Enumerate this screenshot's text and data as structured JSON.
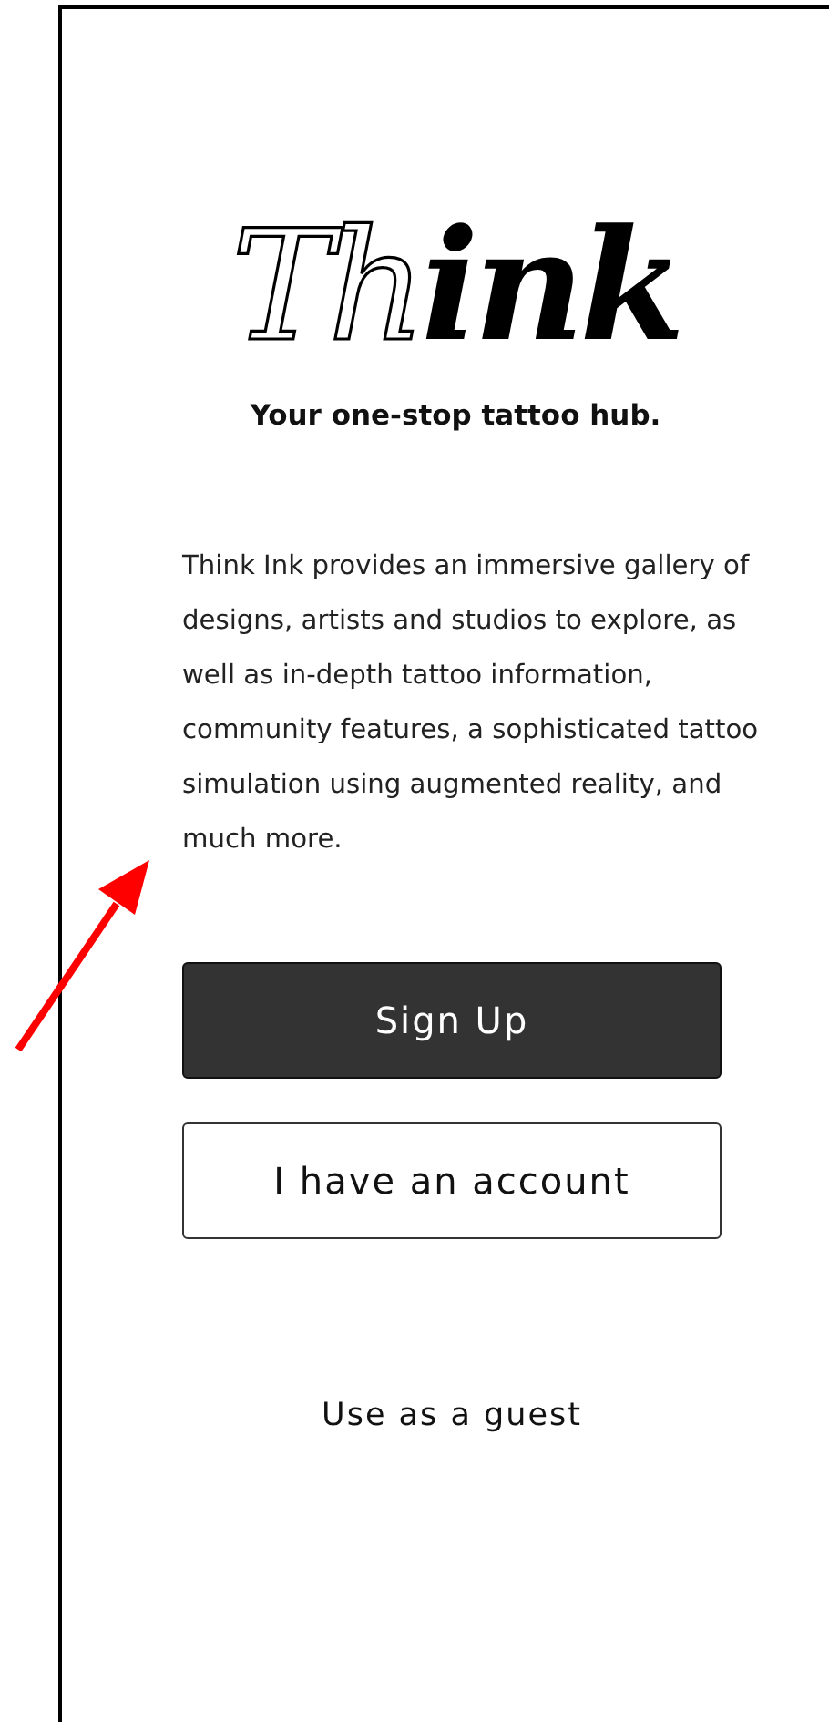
{
  "logo": {
    "outlined_part": "Th",
    "filled_part": "ink"
  },
  "tagline": "Your one-stop tattoo hub.",
  "description": "Think Ink provides an immersive gallery of designs, artists and studios to explore, as well as in-depth tattoo information, community features, a sophisticated tattoo simulation using augmented reality, and much more.",
  "actions": [
    {
      "label": "Sign Up",
      "kind": "filled"
    },
    {
      "label": "I have an account",
      "kind": "outline"
    },
    {
      "label": "Use as a guest",
      "kind": "text"
    }
  ]
}
